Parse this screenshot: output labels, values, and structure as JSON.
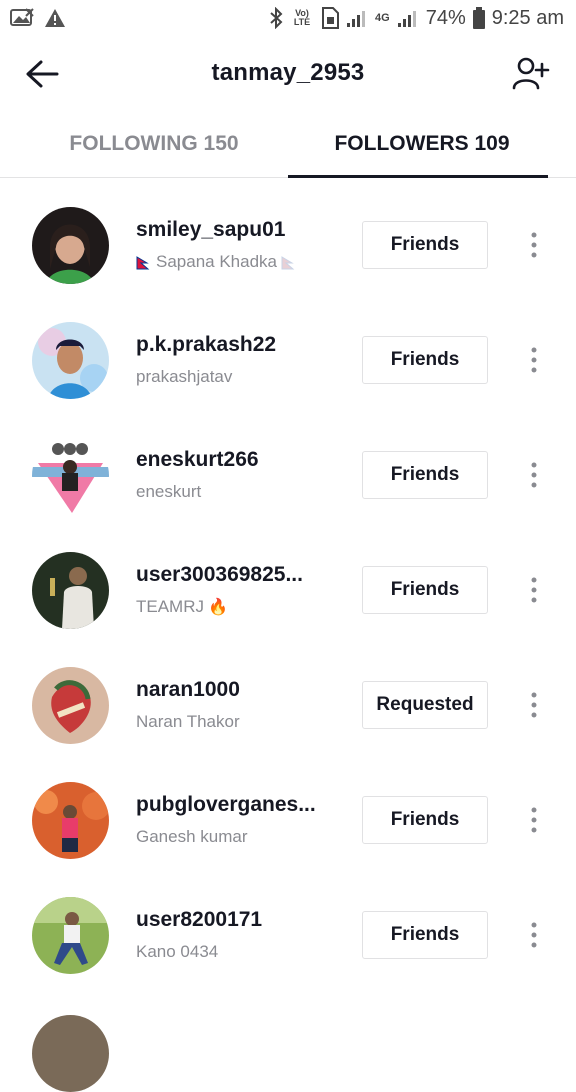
{
  "status_bar": {
    "battery": "74%",
    "time": "9:25 am",
    "volte": "Vo) LTE",
    "network": "4G",
    "icons": [
      "image-icon",
      "warning-icon",
      "bluetooth-icon",
      "volte-icon",
      "sim-icon",
      "signal-icon",
      "4g-signal-icon",
      "battery-icon"
    ]
  },
  "header": {
    "title": "tanmay_2953",
    "back_icon": "arrow-left-icon",
    "add_icon": "add-user-icon"
  },
  "tabs": [
    {
      "label": "FOLLOWING 150",
      "active": false
    },
    {
      "label": "FOLLOWERS 109",
      "active": true
    }
  ],
  "followers": [
    {
      "username": "smiley_sapu01",
      "nickname": "Sapana Khadka",
      "button": "Friends",
      "avatar_color": "#2a2020"
    },
    {
      "username": "p.k.prakash22",
      "nickname": "prakashjatav",
      "button": "Friends",
      "avatar_color": "#6fa3d8"
    },
    {
      "username": "eneskurt266",
      "nickname": "eneskurt",
      "button": "Friends",
      "avatar_color": "#ffffff"
    },
    {
      "username": "user300369825...",
      "nickname": "TEAMRJ",
      "button": "Friends",
      "avatar_color": "#2d3a26"
    },
    {
      "username": "naran1000",
      "nickname": "Naran Thakor",
      "button": "Requested",
      "avatar_color": "#c9a38c"
    },
    {
      "username": "pubgloverganes...",
      "nickname": "Ganesh kumar",
      "button": "Friends",
      "avatar_color": "#d2562a"
    },
    {
      "username": "user8200171",
      "nickname": "Kano 0434",
      "button": "Friends",
      "avatar_color": "#7aa048"
    }
  ],
  "colors": {
    "text_primary": "#161823",
    "text_secondary": "#8a8b91",
    "divider": "#e3e3e4"
  }
}
